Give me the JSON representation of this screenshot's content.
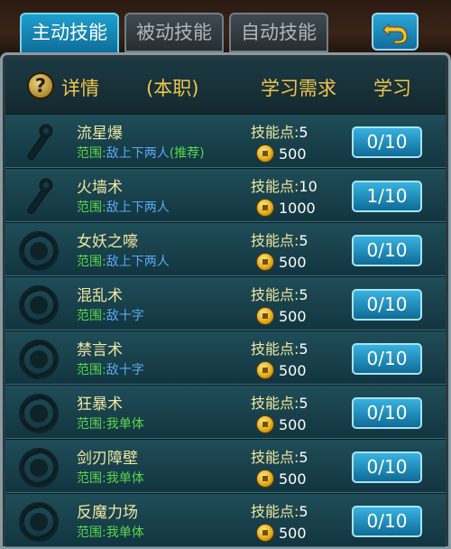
{
  "tabs": [
    {
      "label": "主动技能",
      "active": true
    },
    {
      "label": "被动技能",
      "active": false
    },
    {
      "label": "自动技能",
      "active": false
    }
  ],
  "back_icon": "back-arrow-icon",
  "header": {
    "help_icon": "?",
    "details": "详情",
    "role": "(本职)",
    "requirement": "学习需求",
    "learn": "学习"
  },
  "skills": [
    {
      "name": "流星爆",
      "range_label": "范围:",
      "range": "敌上下两人",
      "range_color": "blue",
      "note": "(推荐)",
      "points_label": "技能点:",
      "points": "5",
      "cost": "500",
      "level": "0/10",
      "icon": "staff-icon"
    },
    {
      "name": "火墙术",
      "range_label": "范围:",
      "range": "敌上下两人",
      "range_color": "blue",
      "note": "",
      "points_label": "技能点:",
      "points": "10",
      "cost": "1000",
      "level": "1/10",
      "icon": "staff-icon"
    },
    {
      "name": "女妖之嚎",
      "range_label": "范围:",
      "range": "敌上下两人",
      "range_color": "blue",
      "note": "",
      "points_label": "技能点:",
      "points": "5",
      "cost": "500",
      "level": "0/10",
      "icon": "swirl-icon"
    },
    {
      "name": "混乱术",
      "range_label": "范围:",
      "range": "敌十字",
      "range_color": "blue",
      "note": "",
      "points_label": "技能点:",
      "points": "5",
      "cost": "500",
      "level": "0/10",
      "icon": "swirl-icon"
    },
    {
      "name": "禁言术",
      "range_label": "范围:",
      "range": "敌十字",
      "range_color": "blue",
      "note": "",
      "points_label": "技能点:",
      "points": "5",
      "cost": "500",
      "level": "0/10",
      "icon": "swirl-icon"
    },
    {
      "name": "狂暴术",
      "range_label": "范围:",
      "range": "我单体",
      "range_color": "green",
      "note": "",
      "points_label": "技能点:",
      "points": "5",
      "cost": "500",
      "level": "0/10",
      "icon": "swirl-icon"
    },
    {
      "name": "剑刃障壁",
      "range_label": "范围:",
      "range": "我单体",
      "range_color": "green",
      "note": "",
      "points_label": "技能点:",
      "points": "5",
      "cost": "500",
      "level": "0/10",
      "icon": "swirl-icon"
    },
    {
      "name": "反魔力场",
      "range_label": "范围:",
      "range": "我单体",
      "range_color": "green",
      "note": "",
      "points_label": "技能点:",
      "points": "5",
      "cost": "500",
      "level": "0/10",
      "icon": "swirl-icon"
    }
  ]
}
